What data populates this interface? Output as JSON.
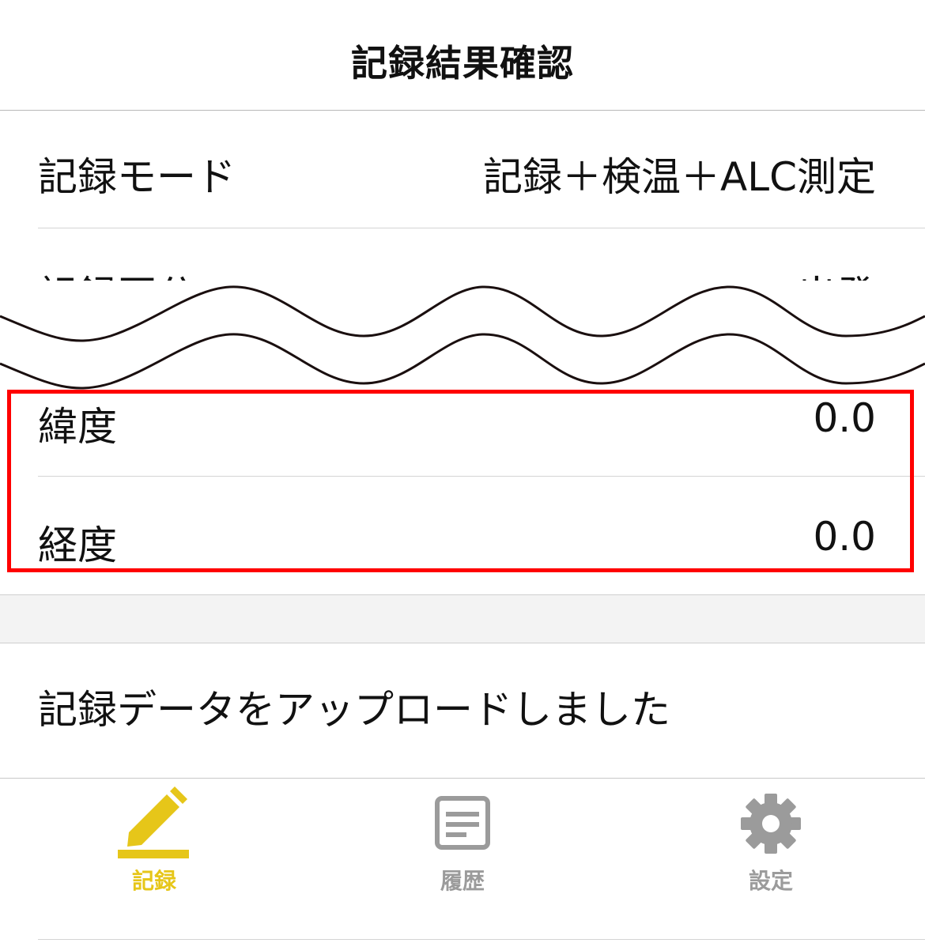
{
  "header": {
    "title": "記録結果確認"
  },
  "rows": [
    {
      "label": "記録モード",
      "value": "記録＋検温＋ALC測定"
    },
    {
      "label": "記録区分",
      "value": "出発"
    },
    {
      "label": "緯度",
      "value": "0.0"
    },
    {
      "label": "経度",
      "value": "0.0"
    }
  ],
  "upload_message": "記録データをアップロードしました",
  "tabbar": {
    "tabs": [
      {
        "label": "記録",
        "icon": "pencil-icon",
        "active": true
      },
      {
        "label": "履歴",
        "icon": "document-icon",
        "active": false
      },
      {
        "label": "設定",
        "icon": "gear-icon",
        "active": false
      }
    ]
  },
  "colors": {
    "accent": "#e6c619",
    "inactive": "#9b9b9b",
    "highlight": "#ff0000"
  }
}
